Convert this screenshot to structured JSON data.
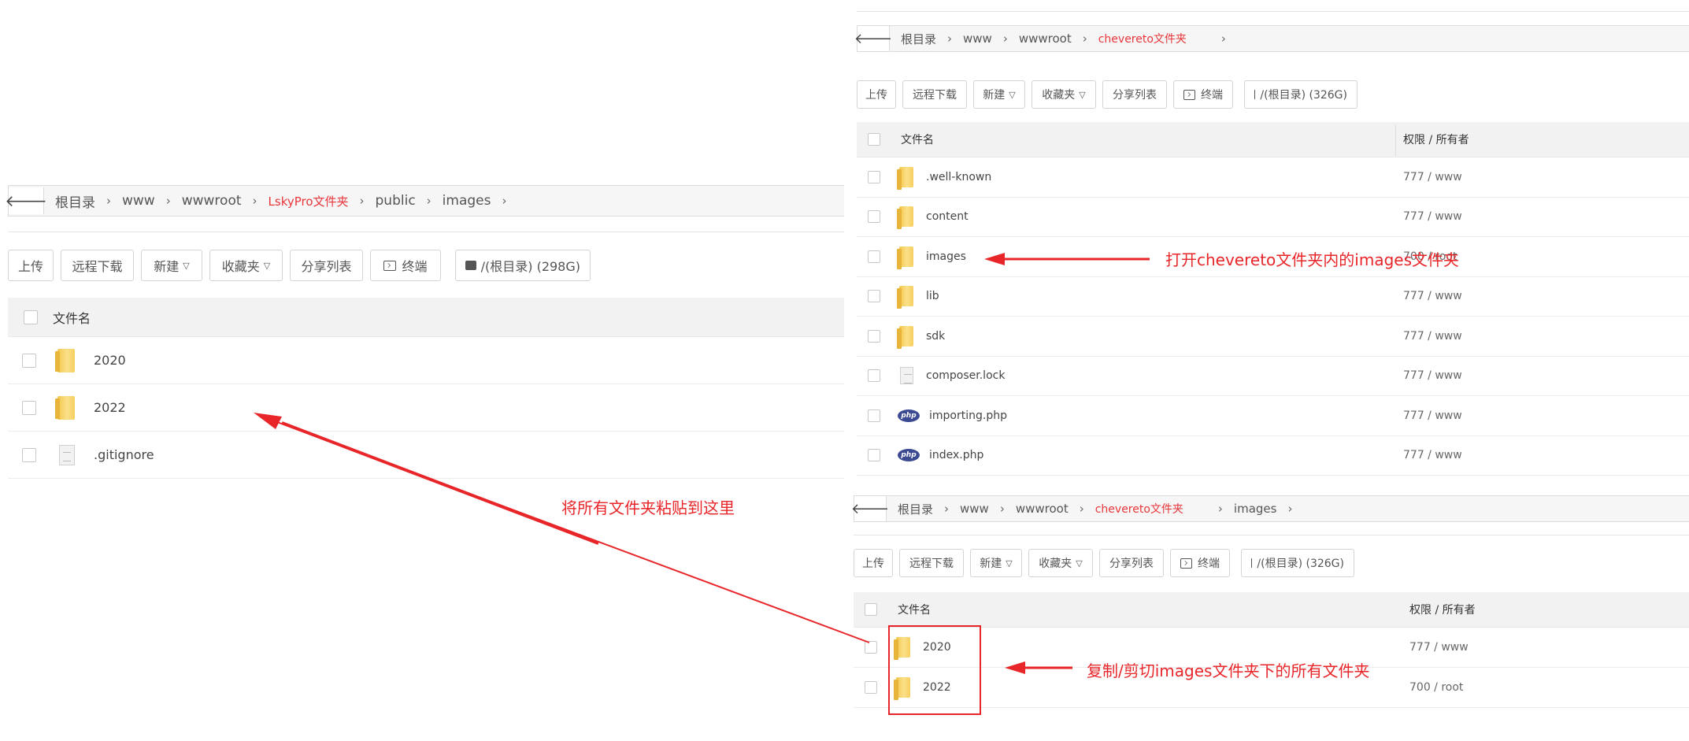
{
  "left": {
    "breadcrumb": [
      "根目录",
      "www",
      "wwwroot",
      "LskyPro文件夹",
      "public",
      "images"
    ],
    "toolbar": [
      "上传",
      "远程下载",
      "新建",
      "收藏夹",
      "分享列表",
      "终端",
      "/(根目录) (298G)"
    ],
    "col_name": "文件名",
    "files": [
      {
        "name": "2020",
        "type": "folder"
      },
      {
        "name": "2022",
        "type": "folder"
      },
      {
        "name": ".gitignore",
        "type": "file"
      }
    ]
  },
  "top_right": {
    "breadcrumb": [
      "根目录",
      "www",
      "wwwroot",
      "chevereto文件夹"
    ],
    "toolbar": [
      "上传",
      "远程下载",
      "新建",
      "收藏夹",
      "分享列表",
      "终端",
      "/(根目录) (326G)"
    ],
    "col_name": "文件名",
    "col_perm": "权限 / 所有者",
    "files": [
      {
        "name": ".well-known",
        "type": "folder",
        "perm": "777 / www"
      },
      {
        "name": "content",
        "type": "folder",
        "perm": "777 / www"
      },
      {
        "name": "images",
        "type": "folder",
        "perm": "700 / root"
      },
      {
        "name": "lib",
        "type": "folder",
        "perm": "777 / www"
      },
      {
        "name": "sdk",
        "type": "folder",
        "perm": "777 / www"
      },
      {
        "name": "composer.lock",
        "type": "file",
        "perm": "777 / www"
      },
      {
        "name": "importing.php",
        "type": "php",
        "perm": "777 / www"
      },
      {
        "name": "index.php",
        "type": "php",
        "perm": "777 / www"
      }
    ]
  },
  "bottom_right": {
    "breadcrumb": [
      "根目录",
      "www",
      "wwwroot",
      "chevereto文件夹",
      "images"
    ],
    "toolbar": [
      "上传",
      "远程下载",
      "新建",
      "收藏夹",
      "分享列表",
      "终端",
      "/(根目录) (326G)"
    ],
    "col_name": "文件名",
    "col_perm": "权限 / 所有者",
    "files": [
      {
        "name": "2020",
        "type": "folder",
        "perm": "777 / www"
      },
      {
        "name": "2022",
        "type": "folder",
        "perm": "700 / root"
      }
    ]
  },
  "php_badge": "php",
  "annotations": {
    "paste_here": "将所有文件夹粘贴到这里",
    "open_images": "打开chevereto文件夹内的images文件夹",
    "copy_cut": "复制/剪切images文件夹下的所有文件夹"
  },
  "colors": {
    "annotation": "#e8262a",
    "active_crumb": "#e8363a"
  }
}
